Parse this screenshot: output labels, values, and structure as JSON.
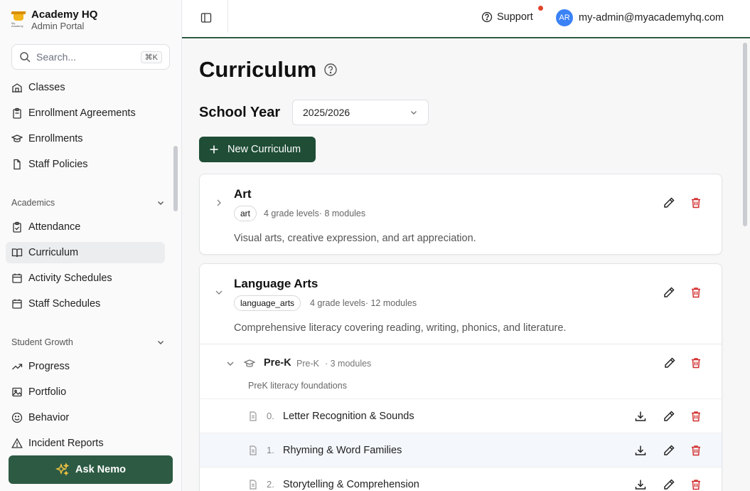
{
  "brand": {
    "title": "Academy HQ",
    "subtitle": "Admin Portal",
    "logo_text": "My Academy"
  },
  "search": {
    "placeholder": "Search...",
    "shortcut": "⌘K"
  },
  "nav": {
    "items_top": [
      {
        "label": "Classes",
        "icon": "school-icon"
      },
      {
        "label": "Enrollment Agreements",
        "icon": "clipboard-icon"
      },
      {
        "label": "Enrollments",
        "icon": "graduation-cap-icon"
      },
      {
        "label": "Staff Policies",
        "icon": "file-icon"
      }
    ],
    "section_academics": "Academics",
    "items_academics": [
      {
        "label": "Attendance",
        "icon": "clipboard-check-icon"
      },
      {
        "label": "Curriculum",
        "icon": "book-open-icon",
        "active": true
      },
      {
        "label": "Activity Schedules",
        "icon": "calendar-icon"
      },
      {
        "label": "Staff Schedules",
        "icon": "calendar-icon"
      }
    ],
    "section_growth": "Student Growth",
    "items_growth": [
      {
        "label": "Progress",
        "icon": "trending-up-icon"
      },
      {
        "label": "Portfolio",
        "icon": "image-icon"
      },
      {
        "label": "Behavior",
        "icon": "smile-icon"
      },
      {
        "label": "Incident Reports",
        "icon": "alert-triangle-icon"
      }
    ]
  },
  "ask_button": "Ask Nemo",
  "topbar": {
    "support": "Support",
    "avatar_initials": "AR",
    "user_email": "my-admin@myacademyhq.com"
  },
  "page": {
    "title": "Curriculum",
    "school_year_label": "School Year",
    "school_year_value": "2025/2026",
    "new_button": "New Curriculum"
  },
  "curricula": [
    {
      "name": "Art",
      "tag": "art",
      "meta": "4 grade levels· 8 modules",
      "description": "Visual arts, creative expression, and art appreciation."
    },
    {
      "name": "Language Arts",
      "tag": "language_arts",
      "meta": "4 grade levels· 12 modules",
      "description": "Comprehensive literacy covering reading, writing, phonics, and literature.",
      "grade": {
        "name": "Pre-K",
        "code": "Pre-K",
        "modules": "· 3 modules",
        "description": "PreK literacy foundations"
      },
      "modules": [
        {
          "num": "0.",
          "name": "Letter Recognition & Sounds"
        },
        {
          "num": "1.",
          "name": "Rhyming & Word Families"
        },
        {
          "num": "2.",
          "name": "Storytelling & Comprehension"
        }
      ]
    }
  ],
  "colors": {
    "brand_green": "#1f4d36",
    "accent_green": "#2d5a43",
    "delete_red": "#d12c2c",
    "avatar_blue": "#3b82f6"
  }
}
